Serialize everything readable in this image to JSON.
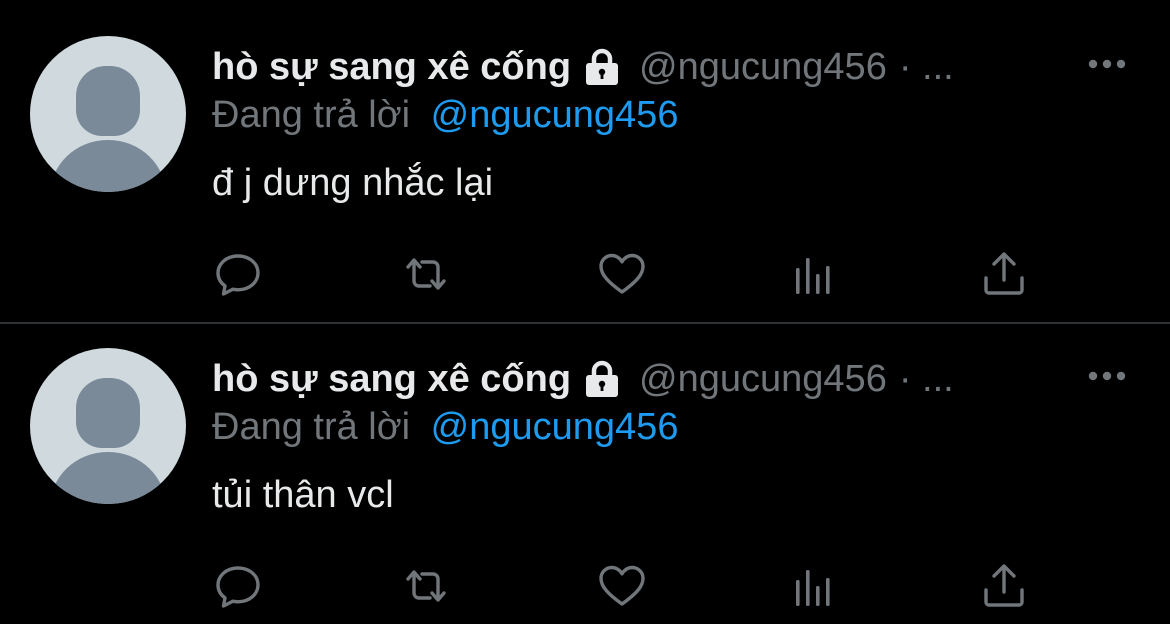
{
  "colors": {
    "background": "#000000",
    "text_primary": "#e7e9ea",
    "text_secondary": "#71767b",
    "accent": "#1d9bf0",
    "divider": "#2f3336",
    "avatar_bg": "#cfd9de",
    "avatar_fg": "#7a8a98"
  },
  "tweets": [
    {
      "display_name": "hò sự sang xê cống",
      "handle": "@ngucung456",
      "separator": "· ...",
      "reply_prefix": "Đang trả lời",
      "reply_to": "@ngucung456",
      "text": "đ j dưng nhắc lại",
      "icons": {
        "lock": "lock-icon",
        "more": "more-dots-icon",
        "reply": "reply-icon",
        "retweet": "retweet-icon",
        "like": "heart-icon",
        "views": "views-chart-icon",
        "share": "share-icon"
      }
    },
    {
      "display_name": "hò sự sang xê cống",
      "handle": "@ngucung456",
      "separator": "· ...",
      "reply_prefix": "Đang trả lời",
      "reply_to": "@ngucung456",
      "text": "tủi thân vcl",
      "icons": {
        "lock": "lock-icon",
        "more": "more-dots-icon",
        "reply": "reply-icon",
        "retweet": "retweet-icon",
        "like": "heart-icon",
        "views": "views-chart-icon",
        "share": "share-icon"
      }
    }
  ]
}
